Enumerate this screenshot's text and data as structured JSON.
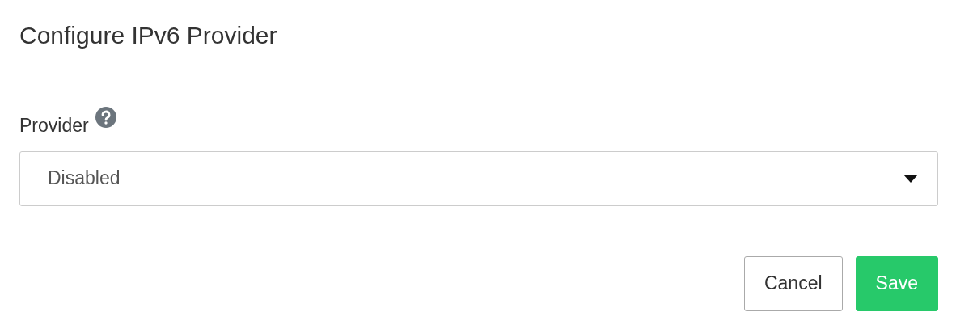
{
  "dialog": {
    "title": "Configure IPv6 Provider"
  },
  "field": {
    "label": "Provider",
    "value": "Disabled"
  },
  "buttons": [
    {
      "label": "Cancel",
      "kind": "secondary"
    },
    {
      "label": "Save",
      "kind": "primary"
    }
  ]
}
